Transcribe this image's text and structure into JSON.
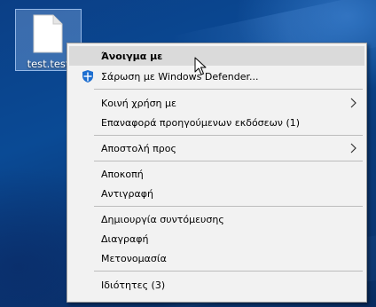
{
  "desktop": {
    "file_label": "test.test"
  },
  "context_menu": {
    "open_with": "Άνοιγμα με",
    "scan_defender": "Σάρωση με Windows Defender...",
    "share_with": "Κοινή χρήση με",
    "restore_versions": "Επαναφορά προηγούμενων εκδόσεων (1)",
    "send_to": "Αποστολή προς",
    "cut": "Αποκοπή",
    "copy": "Αντιγραφή",
    "create_shortcut": "Δημιουργία συντόμευσης",
    "delete": "Διαγραφή",
    "rename": "Μετονομασία",
    "properties": "Ιδιότητες (3)"
  },
  "colors": {
    "menu_background": "#f2f2f2",
    "highlight": "#dadada",
    "defender_blue": "#1e6fd0"
  }
}
